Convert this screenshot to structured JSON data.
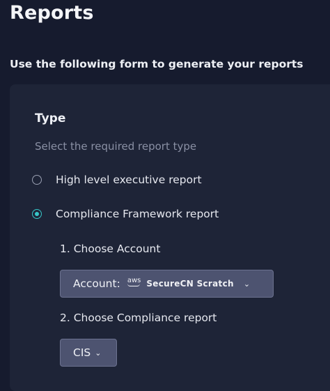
{
  "page": {
    "title": "Reports",
    "intro": "Use the following form to generate your reports"
  },
  "form": {
    "section_title": "Type",
    "section_hint": "Select the required report type",
    "report_types": [
      {
        "label": "High level executive report",
        "selected": false
      },
      {
        "label": "Compliance Framework report",
        "selected": true
      }
    ],
    "step1_label": "1. Choose Account",
    "account_dropdown": {
      "prefix": "Account:",
      "provider_icon": "aws-logo",
      "provider_text": "aws",
      "value": "SecureCN Scratch",
      "icon": "chevron-down-icon"
    },
    "step2_label": "2. Choose Compliance report",
    "compliance_dropdown": {
      "value": "CIS",
      "icon": "chevron-down-icon"
    }
  },
  "colors": {
    "background": "#161b2e",
    "card": "#1e2437",
    "accent": "#37c6c8",
    "dropdown": "#4d5370"
  }
}
